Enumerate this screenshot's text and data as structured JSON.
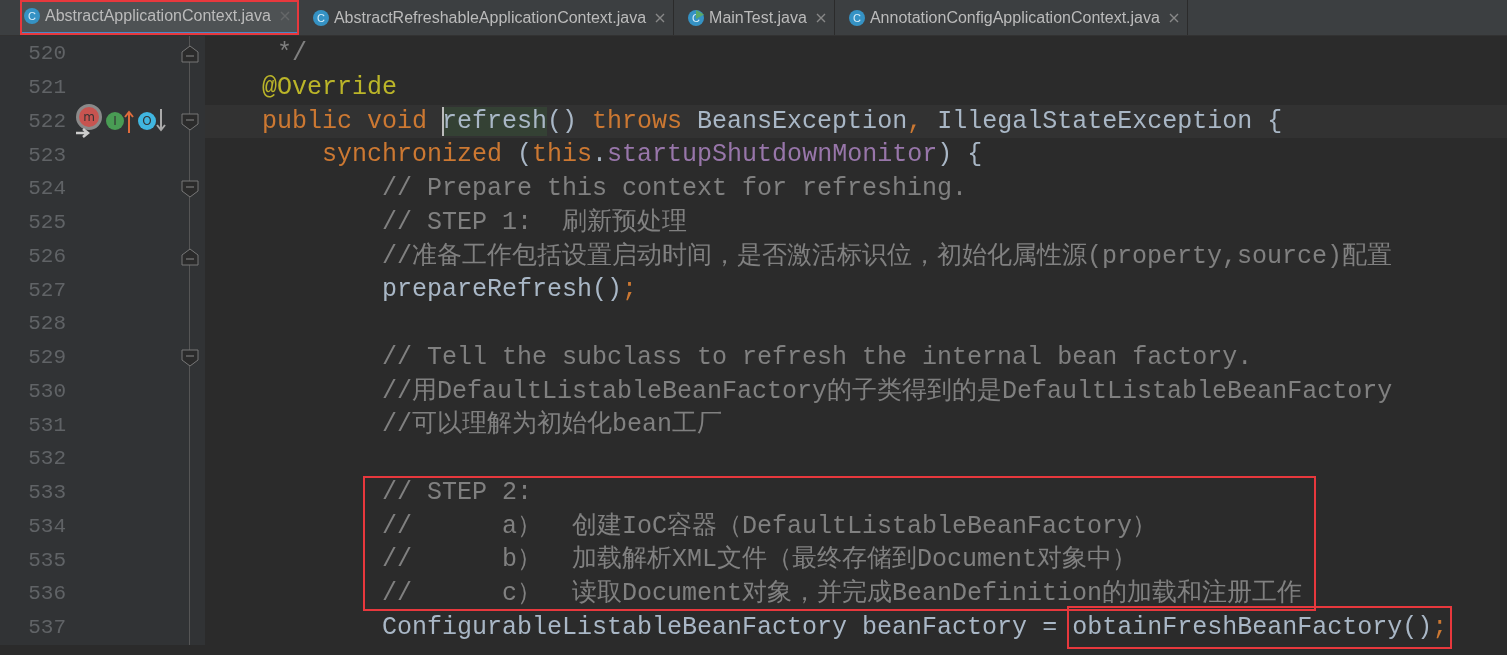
{
  "tabs": [
    {
      "label": "AbstractApplicationContext.java",
      "icon_letter": "C",
      "run_badge": false,
      "selected": true,
      "boxed": true
    },
    {
      "label": "AbstractRefreshableApplicationContext.java",
      "icon_letter": "C",
      "run_badge": false,
      "selected": false,
      "boxed": false
    },
    {
      "label": "MainTest.java",
      "icon_letter": "C",
      "run_badge": true,
      "selected": false,
      "boxed": false
    },
    {
      "label": "AnnotationConfigApplicationContext.java",
      "icon_letter": "C",
      "run_badge": false,
      "selected": false,
      "boxed": false
    }
  ],
  "editor": {
    "lines": [
      {
        "number": "520",
        "fold_end": true,
        "tokens": [
          {
            "kind": "comment",
            "text": " */"
          }
        ]
      },
      {
        "number": "521",
        "tokens": [
          {
            "kind": "annotation",
            "text": "@Override"
          }
        ]
      },
      {
        "number": "522",
        "current": true,
        "fold_start": true,
        "gutter_icons": [
          {
            "kind": "overrides",
            "letter": "m"
          },
          {
            "kind": "implemented",
            "letter": "I"
          },
          {
            "kind": "overridden",
            "letter": "O"
          }
        ],
        "tokens": [
          {
            "kind": "keyword",
            "text": "public void "
          },
          {
            "kind": "usage-highlight",
            "text": "refresh",
            "caret": true
          },
          {
            "kind": "plain",
            "text": "() "
          },
          {
            "kind": "keyword",
            "text": "throws"
          },
          {
            "kind": "plain",
            "text": " BeansException"
          },
          {
            "kind": "punct",
            "text": ","
          },
          {
            "kind": "plain",
            "text": " IllegalStateException {"
          }
        ]
      },
      {
        "number": "523",
        "tokens": [
          {
            "kind": "keyword",
            "text": "    synchronized"
          },
          {
            "kind": "plain",
            "text": " ("
          },
          {
            "kind": "keyword",
            "text": "this"
          },
          {
            "kind": "plain",
            "text": "."
          },
          {
            "kind": "field",
            "text": "startupShutdownMonitor"
          },
          {
            "kind": "plain",
            "text": ") {"
          }
        ]
      },
      {
        "number": "524",
        "fold_start": true,
        "tokens": [
          {
            "kind": "comment",
            "text": "        // Prepare this context for refreshing."
          }
        ]
      },
      {
        "number": "525",
        "tokens": [
          {
            "kind": "comment",
            "text": "        // STEP 1:  刷新预处理"
          }
        ]
      },
      {
        "number": "526",
        "fold_end": true,
        "tokens": [
          {
            "kind": "comment",
            "text": "        //准备工作包括设置启动时间，是否激活标识位，初始化属性源(property,source)配置"
          }
        ]
      },
      {
        "number": "527",
        "tokens": [
          {
            "kind": "plain",
            "text": "        prepareRefresh()"
          },
          {
            "kind": "punct",
            "text": ";"
          }
        ]
      },
      {
        "number": "528"
      },
      {
        "number": "529",
        "fold_start": true,
        "tokens": [
          {
            "kind": "comment",
            "text": "        // Tell the subclass to refresh the internal bean factory."
          }
        ]
      },
      {
        "number": "530",
        "tokens": [
          {
            "kind": "comment",
            "text": "        //用DefaultListableBeanFactory的子类得到的是DefaultListableBeanFactory"
          }
        ]
      },
      {
        "number": "531",
        "tokens": [
          {
            "kind": "comment",
            "text": "        //可以理解为初始化bean工厂"
          }
        ]
      },
      {
        "number": "532"
      },
      {
        "number": "533",
        "boxed": true,
        "tokens": [
          {
            "kind": "comment",
            "text": "// STEP 2:"
          }
        ]
      },
      {
        "number": "534",
        "boxed": true,
        "tokens": [
          {
            "kind": "comment",
            "text": "//      a）  创建IoC容器（DefaultListableBeanFactory）"
          }
        ]
      },
      {
        "number": "535",
        "boxed": true,
        "tokens": [
          {
            "kind": "comment",
            "text": "//      b）  加载解析XML文件（最终存储到Document对象中）"
          }
        ]
      },
      {
        "number": "536",
        "boxed": true,
        "tokens": [
          {
            "kind": "comment",
            "text": "//      c）  读取Document对象，并完成BeanDefinition的加载和注册工作"
          }
        ]
      },
      {
        "number": "537",
        "tokens": [
          {
            "kind": "plain",
            "text": "        ConfigurableListableBeanFactory beanFactory = "
          },
          {
            "kind": "plain",
            "text": "obtainFreshBeanFactory()",
            "boxed": true
          },
          {
            "kind": "punct",
            "text": ";",
            "boxed": true
          }
        ]
      }
    ]
  }
}
